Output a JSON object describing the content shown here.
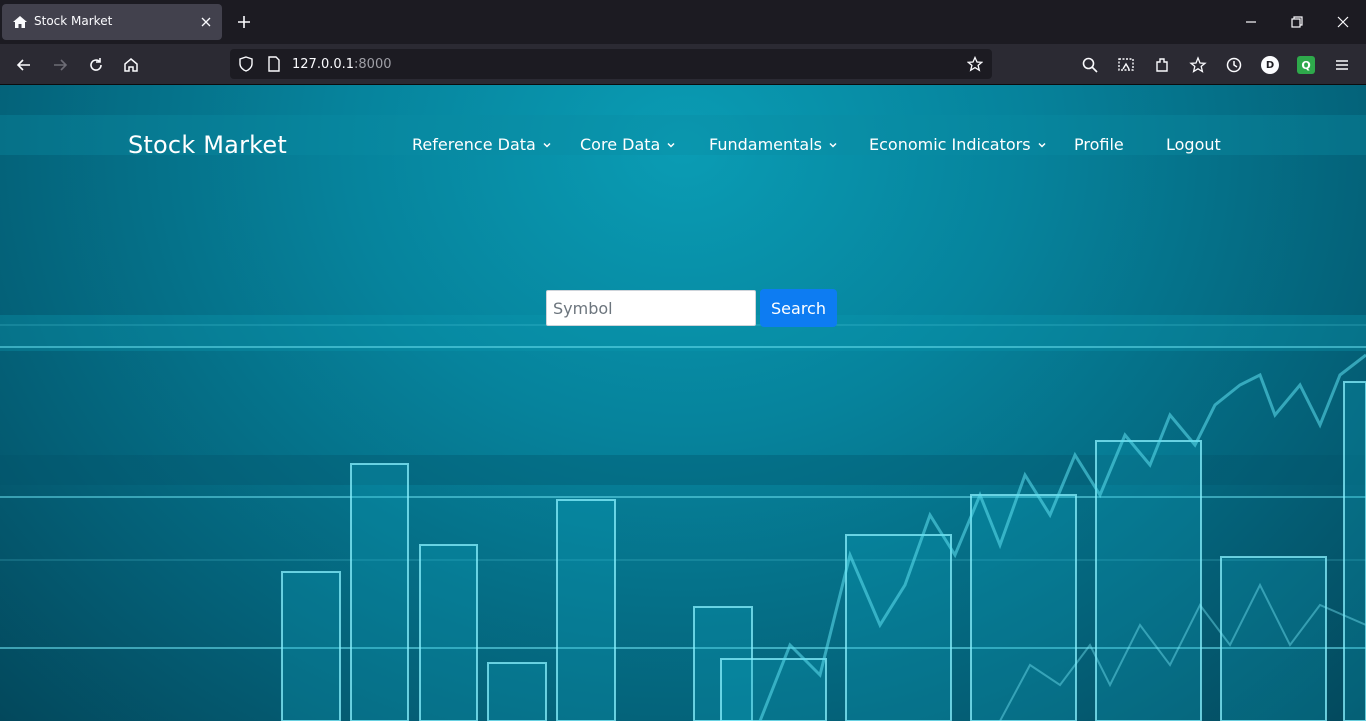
{
  "browser": {
    "tab_title": "Stock Market",
    "url_host": "127.0.0.1",
    "url_port": ":8000",
    "profile_badge": "D",
    "extension_badge": "Q"
  },
  "site": {
    "brand": "Stock Market",
    "nav": [
      {
        "label": "Reference Data",
        "dropdown": true
      },
      {
        "label": "Core Data",
        "dropdown": true
      },
      {
        "label": "Fundamentals",
        "dropdown": true
      },
      {
        "label": "Economic Indicators",
        "dropdown": true
      },
      {
        "label": "Profile",
        "dropdown": false
      },
      {
        "label": "Logout",
        "dropdown": false
      }
    ],
    "search": {
      "placeholder": "Symbol",
      "value": "",
      "button_label": "Search"
    }
  },
  "colors": {
    "accent": "#0d7cf2",
    "background": "#06839c",
    "chrome": "#2b2a33"
  }
}
